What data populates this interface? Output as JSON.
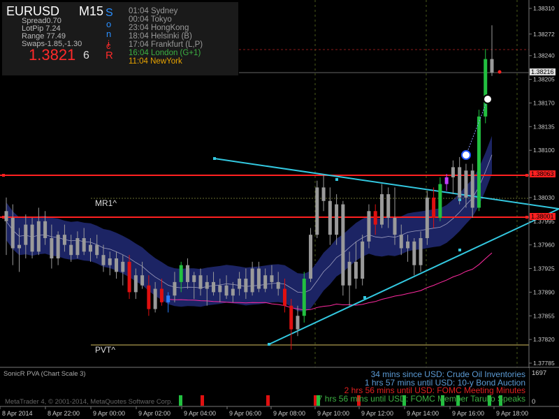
{
  "info": {
    "symbol": "EURUSD",
    "timeframe": "M15",
    "spread": "Spread0.70",
    "lot_pip": "LotPip 7.24",
    "range": "Range 77.49",
    "swaps": "Swaps-1.85,-1.30",
    "price": "1.3821",
    "price_digit": "6",
    "sonic_letters": [
      "S",
      "o",
      "n",
      "i",
      "c",
      "R"
    ],
    "sessions": [
      {
        "time": "01:04",
        "name": "Sydney",
        "color": "#9a9a9a"
      },
      {
        "time": "00:04",
        "name": "Tokyo",
        "color": "#9a9a9a"
      },
      {
        "time": "23:04",
        "name": "HongKong",
        "color": "#9a9a9a"
      },
      {
        "time": "18:04",
        "name": "Helsinki  (B)",
        "color": "#9a9a9a"
      },
      {
        "time": "17:04",
        "name": "Frankfurt  (L,P)",
        "color": "#9a9a9a"
      },
      {
        "time": "16:04",
        "name": "London  (G+1)",
        "color": "#3cb043"
      },
      {
        "time": "11:04",
        "name": "NewYork",
        "color": "#e8a400"
      }
    ]
  },
  "levels": {
    "mr1": "MR1^",
    "pvt": "PVT^",
    "price_tags": [
      "1.38216",
      "1.38063",
      "1.38001"
    ]
  },
  "price_axis": [
    "1.38310",
    "1.38272",
    "1.38240",
    "1.38205",
    "1.38170",
    "1.38135",
    "1.38100",
    "1.38065",
    "1.38030",
    "1.37995",
    "1.37960",
    "1.37925",
    "1.37890",
    "1.37855",
    "1.37820",
    "1.37785"
  ],
  "time_axis": [
    "8 Apr 2014",
    "8 Apr 22:00",
    "9 Apr 00:00",
    "9 Apr 02:00",
    "9 Apr 04:00",
    "9 Apr 06:00",
    "9 Apr 08:00",
    "9 Apr 10:00",
    "9 Apr 12:00",
    "9 Apr 14:00",
    "9 Apr 16:00",
    "9 Apr 18:00"
  ],
  "subwindow": {
    "label": "SonicR PVA  (Chart Scale 3)",
    "scale_top": "1697",
    "scale_bottom": "0",
    "copyright": "MetaTrader 4, © 2001-2014, MetaQuotes Software Corp."
  },
  "news": [
    {
      "text": "34 mins since USD: Crude Oil Inventories",
      "color": "#5b9bd5"
    },
    {
      "text": "1 hrs 57 mins until USD: 10-y Bond Auction",
      "color": "#5b9bd5"
    },
    {
      "text": "2 hrs 56 mins until USD: FOMC Meeting Minutes",
      "color": "#e02020"
    },
    {
      "text": "7 hrs 56 mins until USD: FOMC Member Tarullo Speaks",
      "color": "#3cb043"
    }
  ],
  "chart_data": {
    "type": "candlestick",
    "y_range": [
      1.3777,
      1.3833
    ],
    "x_range": [
      "8 Apr 2014 20:30",
      "9 Apr 18:15"
    ],
    "colors": {
      "neutral": "#9a9a9a",
      "up": "#22c040",
      "down": "#e01010",
      "vol_up": "#2a7fff",
      "vol_high": "#c040ff",
      "band": "#1c2464",
      "support_res": "#ff2020",
      "trend": "#33c8e0",
      "pvt": "#d8c060",
      "ma_pink": "#ff2aa0"
    },
    "candles": [
      {
        "o": 1.37995,
        "h": 1.3803,
        "l": 1.37945,
        "c": 1.3801,
        "k": "n"
      },
      {
        "o": 1.38,
        "h": 1.3802,
        "l": 1.3793,
        "c": 1.37955,
        "k": "n"
      },
      {
        "o": 1.37955,
        "h": 1.37985,
        "l": 1.3792,
        "c": 1.3796,
        "k": "n"
      },
      {
        "o": 1.3796,
        "h": 1.38005,
        "l": 1.3794,
        "c": 1.3799,
        "k": "n"
      },
      {
        "o": 1.3799,
        "h": 1.38,
        "l": 1.3794,
        "c": 1.3795,
        "k": "n"
      },
      {
        "o": 1.3795,
        "h": 1.38015,
        "l": 1.37945,
        "c": 1.37995,
        "k": "n"
      },
      {
        "o": 1.37995,
        "h": 1.3801,
        "l": 1.3796,
        "c": 1.3797,
        "k": "n"
      },
      {
        "o": 1.3797,
        "h": 1.3799,
        "l": 1.37925,
        "c": 1.3794,
        "k": "n"
      },
      {
        "o": 1.3794,
        "h": 1.3798,
        "l": 1.3793,
        "c": 1.37975,
        "k": "n"
      },
      {
        "o": 1.37975,
        "h": 1.3799,
        "l": 1.3795,
        "c": 1.3796,
        "k": "n"
      },
      {
        "o": 1.3796,
        "h": 1.37975,
        "l": 1.37935,
        "c": 1.37945,
        "k": "n"
      },
      {
        "o": 1.37945,
        "h": 1.3798,
        "l": 1.3794,
        "c": 1.3797,
        "k": "n"
      },
      {
        "o": 1.3797,
        "h": 1.37985,
        "l": 1.37945,
        "c": 1.3795,
        "k": "n"
      },
      {
        "o": 1.3795,
        "h": 1.3797,
        "l": 1.37935,
        "c": 1.3796,
        "k": "n"
      },
      {
        "o": 1.3796,
        "h": 1.37975,
        "l": 1.3794,
        "c": 1.37945,
        "k": "n"
      },
      {
        "o": 1.37945,
        "h": 1.3796,
        "l": 1.3792,
        "c": 1.3793,
        "k": "n"
      },
      {
        "o": 1.3793,
        "h": 1.3795,
        "l": 1.37915,
        "c": 1.3794,
        "k": "n"
      },
      {
        "o": 1.3794,
        "h": 1.3795,
        "l": 1.3791,
        "c": 1.3792,
        "k": "n"
      },
      {
        "o": 1.3792,
        "h": 1.37945,
        "l": 1.379,
        "c": 1.37935,
        "k": "n"
      },
      {
        "o": 1.37935,
        "h": 1.37945,
        "l": 1.3788,
        "c": 1.3789,
        "k": "d"
      },
      {
        "o": 1.3789,
        "h": 1.37925,
        "l": 1.3788,
        "c": 1.37915,
        "k": "n"
      },
      {
        "o": 1.37915,
        "h": 1.37935,
        "l": 1.37895,
        "c": 1.379,
        "k": "n"
      },
      {
        "o": 1.379,
        "h": 1.37915,
        "l": 1.37855,
        "c": 1.37865,
        "k": "d"
      },
      {
        "o": 1.37865,
        "h": 1.37905,
        "l": 1.3786,
        "c": 1.37895,
        "k": "n"
      },
      {
        "o": 1.37895,
        "h": 1.3791,
        "l": 1.3787,
        "c": 1.37875,
        "k": "d"
      },
      {
        "o": 1.37875,
        "h": 1.3789,
        "l": 1.3786,
        "c": 1.37885,
        "k": "b"
      },
      {
        "o": 1.37885,
        "h": 1.3792,
        "l": 1.37875,
        "c": 1.37905,
        "k": "n"
      },
      {
        "o": 1.37905,
        "h": 1.37935,
        "l": 1.3789,
        "c": 1.3793,
        "k": "u"
      },
      {
        "o": 1.3793,
        "h": 1.3794,
        "l": 1.37895,
        "c": 1.37905,
        "k": "n"
      },
      {
        "o": 1.37905,
        "h": 1.3792,
        "l": 1.3788,
        "c": 1.37915,
        "k": "n"
      },
      {
        "o": 1.37915,
        "h": 1.37925,
        "l": 1.37885,
        "c": 1.37895,
        "k": "n"
      },
      {
        "o": 1.37895,
        "h": 1.37915,
        "l": 1.3787,
        "c": 1.37905,
        "k": "n"
      },
      {
        "o": 1.37905,
        "h": 1.3792,
        "l": 1.37885,
        "c": 1.3789,
        "k": "n"
      },
      {
        "o": 1.3789,
        "h": 1.3791,
        "l": 1.37875,
        "c": 1.379,
        "k": "n"
      },
      {
        "o": 1.379,
        "h": 1.37915,
        "l": 1.3788,
        "c": 1.37885,
        "k": "n"
      },
      {
        "o": 1.37885,
        "h": 1.37905,
        "l": 1.37875,
        "c": 1.37895,
        "k": "n"
      },
      {
        "o": 1.37895,
        "h": 1.3792,
        "l": 1.37885,
        "c": 1.3791,
        "k": "n"
      },
      {
        "o": 1.3791,
        "h": 1.37925,
        "l": 1.3788,
        "c": 1.3789,
        "k": "n"
      },
      {
        "o": 1.3789,
        "h": 1.37935,
        "l": 1.37885,
        "c": 1.37925,
        "k": "n"
      },
      {
        "o": 1.37925,
        "h": 1.37935,
        "l": 1.3789,
        "c": 1.37895,
        "k": "n"
      },
      {
        "o": 1.37895,
        "h": 1.37925,
        "l": 1.3789,
        "c": 1.37915,
        "k": "n"
      },
      {
        "o": 1.37915,
        "h": 1.3793,
        "l": 1.37895,
        "c": 1.37905,
        "k": "n"
      },
      {
        "o": 1.37905,
        "h": 1.3792,
        "l": 1.37885,
        "c": 1.37895,
        "k": "n"
      },
      {
        "o": 1.37895,
        "h": 1.3791,
        "l": 1.3786,
        "c": 1.3787,
        "k": "d"
      },
      {
        "o": 1.3787,
        "h": 1.3788,
        "l": 1.37805,
        "c": 1.37835,
        "k": "d"
      },
      {
        "o": 1.37835,
        "h": 1.3787,
        "l": 1.37825,
        "c": 1.37855,
        "k": "n"
      },
      {
        "o": 1.37855,
        "h": 1.3792,
        "l": 1.37845,
        "c": 1.3791,
        "k": "u"
      },
      {
        "o": 1.3791,
        "h": 1.37985,
        "l": 1.37905,
        "c": 1.37975,
        "k": "n"
      },
      {
        "o": 1.37975,
        "h": 1.38055,
        "l": 1.3797,
        "c": 1.38045,
        "k": "n"
      },
      {
        "o": 1.38045,
        "h": 1.38065,
        "l": 1.3801,
        "c": 1.38025,
        "k": "n"
      },
      {
        "o": 1.38025,
        "h": 1.38045,
        "l": 1.3796,
        "c": 1.37975,
        "k": "n"
      },
      {
        "o": 1.37975,
        "h": 1.38035,
        "l": 1.3796,
        "c": 1.3802,
        "k": "n"
      },
      {
        "o": 1.3802,
        "h": 1.38025,
        "l": 1.37885,
        "c": 1.379,
        "k": "n"
      },
      {
        "o": 1.379,
        "h": 1.3795,
        "l": 1.3787,
        "c": 1.37935,
        "k": "n"
      },
      {
        "o": 1.37935,
        "h": 1.37965,
        "l": 1.37895,
        "c": 1.3791,
        "k": "n"
      },
      {
        "o": 1.3791,
        "h": 1.37975,
        "l": 1.379,
        "c": 1.37965,
        "k": "n"
      },
      {
        "o": 1.37965,
        "h": 1.3802,
        "l": 1.37955,
        "c": 1.3801,
        "k": "n"
      },
      {
        "o": 1.3801,
        "h": 1.3802,
        "l": 1.37975,
        "c": 1.3799,
        "k": "d"
      },
      {
        "o": 1.3799,
        "h": 1.3805,
        "l": 1.37985,
        "c": 1.38035,
        "k": "n"
      },
      {
        "o": 1.38035,
        "h": 1.38045,
        "l": 1.37985,
        "c": 1.38,
        "k": "n"
      },
      {
        "o": 1.38,
        "h": 1.38045,
        "l": 1.3796,
        "c": 1.37975,
        "k": "n"
      },
      {
        "o": 1.37975,
        "h": 1.3799,
        "l": 1.37945,
        "c": 1.37955,
        "k": "n"
      },
      {
        "o": 1.37955,
        "h": 1.37975,
        "l": 1.37935,
        "c": 1.37965,
        "k": "n"
      },
      {
        "o": 1.37965,
        "h": 1.3797,
        "l": 1.37915,
        "c": 1.3793,
        "k": "n"
      },
      {
        "o": 1.3793,
        "h": 1.3798,
        "l": 1.3792,
        "c": 1.3797,
        "k": "n"
      },
      {
        "o": 1.3797,
        "h": 1.3804,
        "l": 1.3796,
        "c": 1.3803,
        "k": "n"
      },
      {
        "o": 1.3803,
        "h": 1.38045,
        "l": 1.37985,
        "c": 1.38,
        "k": "d"
      },
      {
        "o": 1.38,
        "h": 1.3806,
        "l": 1.37995,
        "c": 1.3805,
        "k": "u"
      },
      {
        "o": 1.3805,
        "h": 1.38065,
        "l": 1.3804,
        "c": 1.3806,
        "k": "p"
      },
      {
        "o": 1.3806,
        "h": 1.38085,
        "l": 1.38035,
        "c": 1.38075,
        "k": "n"
      },
      {
        "o": 1.38075,
        "h": 1.3809,
        "l": 1.3802,
        "c": 1.3803,
        "k": "n"
      },
      {
        "o": 1.3803,
        "h": 1.3808,
        "l": 1.38015,
        "c": 1.3807,
        "k": "n"
      },
      {
        "o": 1.3807,
        "h": 1.3808,
        "l": 1.38,
        "c": 1.38015,
        "k": "n"
      },
      {
        "o": 1.38015,
        "h": 1.3816,
        "l": 1.3801,
        "c": 1.3815,
        "k": "u"
      },
      {
        "o": 1.3815,
        "h": 1.3825,
        "l": 1.3814,
        "c": 1.38235,
        "k": "u"
      },
      {
        "o": 1.38235,
        "h": 1.38285,
        "l": 1.3821,
        "c": 1.38215,
        "k": "n"
      }
    ],
    "horizontal_lines": [
      1.38063,
      1.38001
    ],
    "current_price": 1.38216,
    "volume_top": 1697
  }
}
